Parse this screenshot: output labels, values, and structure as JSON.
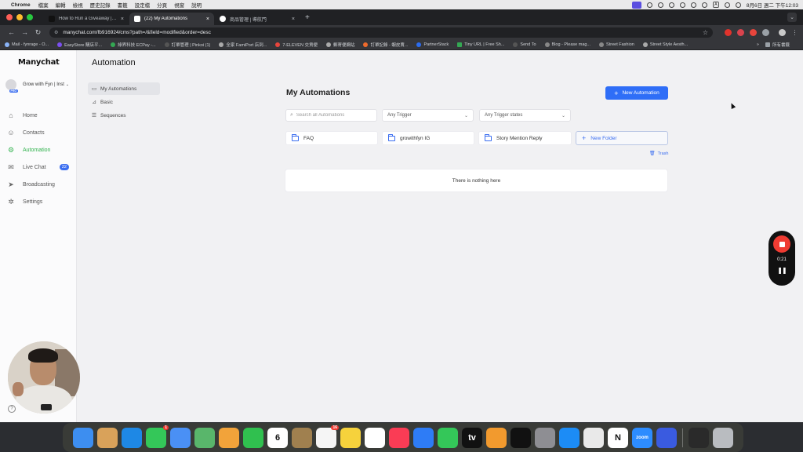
{
  "menubar": {
    "app": "Chrome",
    "items": [
      "檔案",
      "編輯",
      "檢視",
      "歷史記錄",
      "書籤",
      "設定檔",
      "分頁",
      "視窗",
      "說明"
    ],
    "clock": "8月6日 週二 下午12:03"
  },
  "browser": {
    "tabs": [
      {
        "title": "How to Run a Giveaway | Mo",
        "active": false
      },
      {
        "title": "(22) My Automations",
        "active": true
      },
      {
        "title": "商品管理 | 導航門",
        "active": false
      }
    ],
    "new_tab": "+",
    "url": "manychat.com/fb916924/cms?path=/&field=modified&order=desc",
    "bookmarks": [
      "Mail - fynrage - O...",
      "EasyStore 購店平...",
      "綠界科技 ECPay -...",
      "訂單管理 | Pinkoi (1)",
      "全家 FamiPort 店到...",
      "7-ELEVEN 交貨便",
      "郵寄便網站",
      "訂單記錄 - 蝦皮賣...",
      "PartnerStack",
      "Tiny URL | Free Sh...",
      "Send To",
      "Blog - Please mag...",
      "Street Fashion",
      "Street Style Aesth..."
    ],
    "bookmarks_more": "»",
    "all_bookmarks": "所有書籤"
  },
  "sidebar": {
    "logo": "Manychat",
    "account": "Grow with Fyn | Inst",
    "pro_badge": "PRO",
    "items": [
      {
        "label": "Home",
        "icon": "home-icon",
        "glyph": "⌂"
      },
      {
        "label": "Contacts",
        "icon": "contacts-icon",
        "glyph": "☺"
      },
      {
        "label": "Automation",
        "icon": "automation-icon",
        "glyph": "⚙",
        "active": true
      },
      {
        "label": "Live Chat",
        "icon": "chat-icon",
        "glyph": "✉",
        "badge": "22"
      },
      {
        "label": "Broadcasting",
        "icon": "broadcast-icon",
        "glyph": "➤"
      },
      {
        "label": "Settings",
        "icon": "settings-icon",
        "glyph": "✲"
      }
    ],
    "help": "?"
  },
  "header": {
    "title": "Automation"
  },
  "subnav": [
    {
      "label": "My Automations",
      "active": true
    },
    {
      "label": "Basic"
    },
    {
      "label": "Sequences"
    }
  ],
  "main": {
    "title": "My Automations",
    "new_automation": "New Automation",
    "search_placeholder": "Search all Automations",
    "trigger_select": "Any Trigger",
    "trigger_state_select": "Any Trigger states",
    "folders": [
      "FAQ",
      "growithfyn IG",
      "Story Mention Reply"
    ],
    "new_folder": "New Folder",
    "trash": "Trash",
    "empty_message": "There is nothing here"
  },
  "recorder": {
    "time": "0:21"
  },
  "dock": {
    "apps": [
      {
        "name": "finder",
        "color": "#3d8ef0"
      },
      {
        "name": "launchpad",
        "color": "#d9a25a"
      },
      {
        "name": "safari",
        "color": "#1e88e5"
      },
      {
        "name": "messages",
        "color": "#34c759",
        "badge": "1"
      },
      {
        "name": "mail",
        "color": "#4a90f5"
      },
      {
        "name": "maps",
        "color": "#59b66b"
      },
      {
        "name": "photos",
        "color": "#f2a33a"
      },
      {
        "name": "facetime",
        "color": "#30c04f"
      },
      {
        "name": "calendar",
        "color": "#ffffff",
        "label": "6"
      },
      {
        "name": "notes-brown",
        "color": "#a0804f"
      },
      {
        "name": "reminders",
        "color": "#f5f5f5",
        "badge": "16"
      },
      {
        "name": "notes",
        "color": "#f6d23c"
      },
      {
        "name": "freeform",
        "color": "#ffffff"
      },
      {
        "name": "music",
        "color": "#fa3c55"
      },
      {
        "name": "keynote",
        "color": "#2e7cf6"
      },
      {
        "name": "numbers",
        "color": "#34c759"
      },
      {
        "name": "tv",
        "color": "#111111",
        "label": "tv"
      },
      {
        "name": "pages",
        "color": "#f29a2e"
      },
      {
        "name": "capcut",
        "color": "#111111"
      },
      {
        "name": "system-settings",
        "color": "#8e8e93"
      },
      {
        "name": "app-store",
        "color": "#1c8cf6"
      },
      {
        "name": "chrome",
        "color": "#e9e9e9"
      },
      {
        "name": "notion",
        "color": "#ffffff",
        "label": "N"
      },
      {
        "name": "zoom",
        "color": "#2d8cff",
        "label": "zoom"
      },
      {
        "name": "perplexity",
        "color": "#3a5be0"
      }
    ]
  }
}
